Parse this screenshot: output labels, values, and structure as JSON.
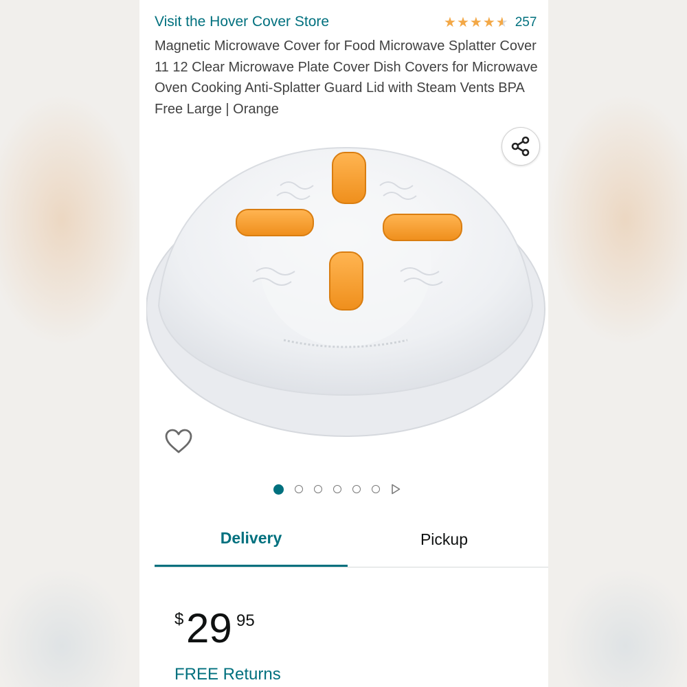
{
  "store": {
    "link": "Visit the Hover Cover Store"
  },
  "rating": {
    "stars": 4.5,
    "count": "257",
    "star_color": "#f3a847"
  },
  "product": {
    "title": "Magnetic Microwave Cover for Food Microwave Splatter Cover 11 12 Clear Microwave Plate Cover Dish Covers for Microwave Oven Cooking Anti-Splatter Guard Lid with Steam Vents BPA Free Large | Orange"
  },
  "carousel": {
    "total_images": 6,
    "active_index": 0
  },
  "tabs": [
    {
      "label": "Delivery",
      "selected": true
    },
    {
      "label": "Pickup",
      "selected": false
    }
  ],
  "price": {
    "symbol": "$",
    "whole": "29",
    "fraction": "95"
  },
  "returns": {
    "label": "FREE Returns"
  },
  "icons": {
    "share": "share-icon",
    "wishlist": "heart-icon",
    "next": "play-next-icon"
  },
  "colors": {
    "accent": "#00707e",
    "vent_orange": "#f5a030"
  }
}
